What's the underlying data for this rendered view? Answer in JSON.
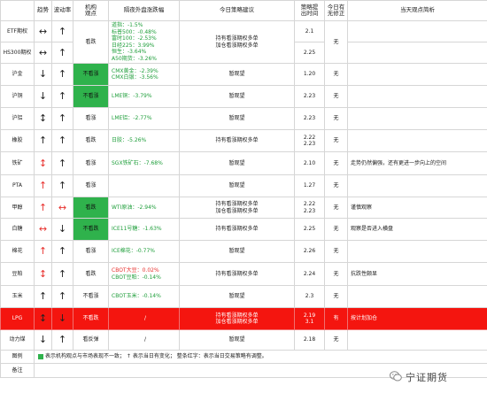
{
  "headers": {
    "name": "",
    "trend": "趋势",
    "vol": "波动率",
    "inst": "机构\n观点",
    "ext": "隔夜外盘涨跌幅",
    "sugg": "今日策略建议",
    "time": "策略提\n出时间",
    "change": "今日有\n无修正",
    "view": "当天观点简析"
  },
  "rows": [
    {
      "id": "etf",
      "name": "ETF期权",
      "trend": "↔",
      "trend_color": "blk",
      "vol": "↑",
      "vol_color": "blk",
      "inst": "",
      "inst_green": false,
      "ext": [],
      "sugg": [],
      "time": [
        "2.1"
      ],
      "change": "",
      "view": [],
      "h": 24
    },
    {
      "id": "hs300",
      "name": "HS300期权",
      "trend": "↔",
      "trend_color": "blk",
      "vol": "↑",
      "vol_color": "blk",
      "inst": "",
      "inst_green": false,
      "ext": [],
      "sugg": [],
      "time": [
        "2.25"
      ],
      "change": "",
      "view": [],
      "h": 24
    },
    {
      "id": "cu",
      "name": "沪金",
      "trend": "↓",
      "trend_color": "blk",
      "vol": "↑",
      "vol_color": "blk",
      "inst": "不看涨",
      "inst_green": true,
      "ext": [
        {
          "t": "CMX黄金：-2.39%"
        },
        {
          "t": "CMX白银：-3.56%"
        }
      ],
      "sugg": [
        "暂观望"
      ],
      "time": [
        "1.20"
      ],
      "change": "无",
      "view": [],
      "h": 25
    },
    {
      "id": "cu2",
      "name": "沪铜",
      "trend": "↓",
      "trend_color": "blk",
      "vol": "↑",
      "vol_color": "blk",
      "inst": "不看涨",
      "inst_green": true,
      "ext": [
        {
          "t": "LME铜：-3.79%"
        }
      ],
      "sugg": [
        "暂观望"
      ],
      "time": [
        "2.23"
      ],
      "change": "无",
      "view": [],
      "h": 25
    },
    {
      "id": "al",
      "name": "沪铝",
      "trend": "↕",
      "trend_color": "blk",
      "vol": "↑",
      "vol_color": "blk",
      "inst": "看涨",
      "inst_green": false,
      "ext": [
        {
          "t": "LME铝：-2.77%"
        }
      ],
      "sugg": [
        "暂观望"
      ],
      "time": [
        "2.23"
      ],
      "change": "无",
      "view": [],
      "h": 25
    },
    {
      "id": "rub",
      "name": "橡胶",
      "trend": "↑",
      "trend_color": "blk",
      "vol": "↑",
      "vol_color": "blk",
      "inst": "看跌",
      "inst_green": false,
      "ext": [
        {
          "t": "日胶：-5.26%"
        }
      ],
      "sugg": [
        "持有看涨期权多单"
      ],
      "time": [
        "2.22",
        "2.23"
      ],
      "change": "无",
      "view": [],
      "h": 25
    },
    {
      "id": "ore",
      "name": "铁矿",
      "trend": "↕",
      "trend_color": "red",
      "vol": "↑",
      "vol_color": "blk",
      "inst": "看涨",
      "inst_green": false,
      "ext": [
        {
          "t": "SGX铁矿石：-7.68%"
        }
      ],
      "sugg": [
        "暂观望"
      ],
      "time": [
        "2.10"
      ],
      "change": "无",
      "view": [
        "走势仍然偏强，还有更进一步向上的空间"
      ],
      "h": 26
    },
    {
      "id": "pta",
      "name": "PTA",
      "trend": "↑",
      "trend_color": "red",
      "vol": "↑",
      "vol_color": "blk",
      "inst": "看涨",
      "inst_green": false,
      "ext": [],
      "sugg": [
        "暂观望"
      ],
      "time": [
        "1.27"
      ],
      "change": "无",
      "view": [],
      "h": 25
    },
    {
      "id": "meoh",
      "name": "甲醇",
      "trend": "↑",
      "trend_color": "red",
      "vol": "↔",
      "vol_color": "red",
      "inst": "看跌",
      "inst_green": true,
      "ext": [
        {
          "t": "WTI原油：-2.94%"
        }
      ],
      "sugg": [
        "持有看涨期权多单",
        "加仓看涨期权多单"
      ],
      "time": [
        "2.22",
        "2.23"
      ],
      "change": "无",
      "view": [
        "谨慎观察"
      ],
      "h": 24
    },
    {
      "id": "sug",
      "name": "白糖",
      "trend": "↔",
      "trend_color": "red",
      "vol": "↓",
      "vol_color": "blk",
      "inst": "不看跌",
      "inst_green": true,
      "ext": [
        {
          "t": "ICE11号糖：-1.63%"
        }
      ],
      "sugg": [
        "持有看涨期权多单"
      ],
      "time": [
        "2.25"
      ],
      "change": "无",
      "view": [
        "观察是否进入横盘"
      ],
      "h": 25
    },
    {
      "id": "cot",
      "name": "棉花",
      "trend": "↑",
      "trend_color": "red",
      "vol": "↑",
      "vol_color": "blk",
      "inst": "看涨",
      "inst_green": false,
      "ext": [
        {
          "t": "ICE棉花：-0.77%"
        }
      ],
      "sugg": [
        "暂观望"
      ],
      "time": [
        "2.26"
      ],
      "change": "无",
      "view": [],
      "h": 25
    },
    {
      "id": "soy",
      "name": "豆粕",
      "trend": "↕",
      "trend_color": "red",
      "vol": "↑",
      "vol_color": "blk",
      "inst": "看跌",
      "inst_green": false,
      "ext": [
        {
          "t": "CBOT大豆：0.02%",
          "red": true
        },
        {
          "t": "CBOT豆粕：-0.14%"
        }
      ],
      "sugg": [
        "持有看涨期权多单"
      ],
      "time": [
        "2.24"
      ],
      "change": "无",
      "view": [
        "抗跌性颇显"
      ],
      "h": 26
    },
    {
      "id": "corn",
      "name": "玉米",
      "trend": "↑",
      "trend_color": "blk",
      "vol": "↑",
      "vol_color": "blk",
      "inst": "不看涨",
      "inst_green": false,
      "ext": [
        {
          "t": "CBOT玉米：-0.14%"
        }
      ],
      "sugg": [
        "暂观望"
      ],
      "time": [
        "2.3"
      ],
      "change": "无",
      "view": [],
      "h": 25
    },
    {
      "id": "lpg",
      "name": "LPG",
      "trend": "↕",
      "trend_color": "blk",
      "vol": "↓",
      "vol_color": "blk",
      "inst": "不看跌",
      "inst_green": false,
      "ext": [
        {
          "t": "/"
        }
      ],
      "sugg": [
        "持有看涨期权多单",
        "加仓看涨期权多单"
      ],
      "time": [
        "2.19",
        "3.1"
      ],
      "change": "有",
      "view": [
        "按计划加仓"
      ],
      "h": 25,
      "highlight": true
    },
    {
      "id": "coal",
      "name": "动力煤",
      "trend": "↓",
      "trend_color": "blk",
      "vol": "↑",
      "vol_color": "blk",
      "inst": "看反弹",
      "inst_green": false,
      "ext": [
        {
          "t": "/"
        }
      ],
      "sugg": [
        "暂观望"
      ],
      "time": [
        "2.18"
      ],
      "change": "无",
      "view": [],
      "h": 23
    }
  ],
  "etf_hs300_merged": {
    "inst": "看跌",
    "ext": [
      "道指：-1.5%",
      "标普500：-0.48%",
      "富时100：-2.53%",
      "日经225：3.99%",
      "恒生：-3.64%",
      "A50期货：-3.26%"
    ],
    "sugg": [
      "持有看涨期权多单",
      "加仓看涨期权多单"
    ],
    "change": "无"
  },
  "legend": {
    "label": "图例",
    "text": "表示机构观点与市场表现不一致；  ↑ 表示当日有变化；  整条红字：表示当日交易策略有调整。",
    "notes_label": "备注",
    "notes_text": ""
  },
  "watermark": "宁证期货",
  "colors": {
    "green": "#2fb24c",
    "red": "#f4150f",
    "text_green": "#1e9e3a",
    "text_red": "#e8322f"
  }
}
